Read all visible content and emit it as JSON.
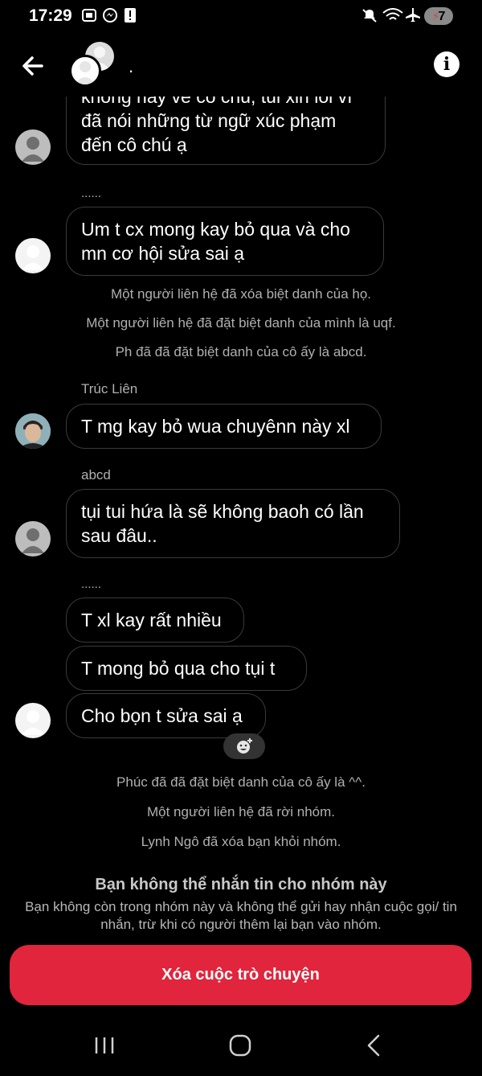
{
  "status_bar": {
    "time": "17:29",
    "battery": "7",
    "icons": [
      "screenshot-icon",
      "messenger-icon",
      "alert-icon",
      "mute-icon",
      "wifi-icon",
      "airplane-icon"
    ]
  },
  "header": {
    "title": ".",
    "info_label": "i"
  },
  "chat": {
    "msg1": "không hay về cô chú, tui xin lỗi vì đã nói những từ ngữ xúc phạm đến cô chú ạ",
    "dots1": "......",
    "msg2": "Um t cx mong kay bỏ qua và cho mn cơ hội sửa sai ạ",
    "sys1": "Một người liên hệ đã xóa biệt danh của họ.",
    "sys2": "Một người liên hệ đã đặt biệt danh của mình là uqf.",
    "sys3": "Ph đã đã đặt biệt danh của cô ấy là abcd.",
    "sender1": "Trúc Liên",
    "msg3": "T mg kay bỏ wua chuyênn này xl",
    "sender2": "abcd",
    "msg4": "tụi tui hứa là sẽ không baoh có lần sau đâu..",
    "dots2": "......",
    "msg5": "T xl kay rất nhiều",
    "msg6": "T mong bỏ qua cho tụi t",
    "msg7": "Cho bọn t sửa sai ạ",
    "sys4": "Phúc đã đã đặt biệt danh của cô ấy là ^^.",
    "sys5": "Một người liên hệ đã rời nhóm.",
    "sys6": "Lynh Ngô đã xóa bạn khỏi nhóm."
  },
  "footer": {
    "title": "Bạn không thể nhắn tin cho nhóm này",
    "text": "Bạn không còn trong nhóm này và không thể gửi hay nhận cuộc gọi/ tin nhắn, trừ khi có người thêm lại bạn vào nhóm.",
    "delete_label": "Xóa cuộc trò chuyện"
  },
  "colors": {
    "background": "#000000",
    "accent_red": "#e0253c",
    "bubble_border": "#3a3a3a",
    "muted_text": "#b0b0b0"
  }
}
